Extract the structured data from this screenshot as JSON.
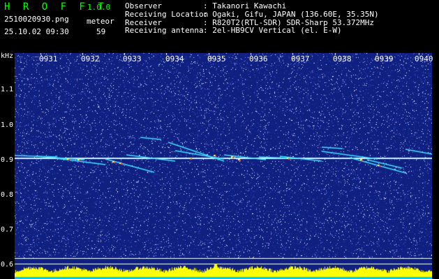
{
  "header": {
    "app_name": "H R O F F T",
    "version": "1.0.0",
    "filename": "2510020930.png",
    "meteor_label": "meteor",
    "datetime": "25.10.02 09:30",
    "meteor_count": "59"
  },
  "info": [
    {
      "key": "Observer",
      "value": ": Takanori Kawachi"
    },
    {
      "key": "Receiving Location",
      "value": ": Ogaki, Gifu, JAPAN (136.60E, 35.35N)"
    },
    {
      "key": "Receiver",
      "value": ": R820T2(RTL-SDR) SDR-Sharp 53.372MHz"
    },
    {
      "key": "Receiving antenna",
      "value": ": 2el-HB9CV Vertical (el. E-W)"
    }
  ],
  "axis": {
    "unit": "kHz",
    "y_labels": [
      "1.1",
      "1.0",
      "0.9",
      "0.8",
      "0.7",
      "0.6"
    ],
    "time_labels": [
      "0931",
      "0932",
      "0933",
      "0934",
      "0935",
      "0936",
      "0937",
      "0938",
      "0939",
      "0940"
    ]
  },
  "colors": {
    "background": "#102080",
    "carrier": "#c8f0ff",
    "meteor": "#40e0ff",
    "hot": "#ffff40",
    "level": "#ffff00"
  }
}
